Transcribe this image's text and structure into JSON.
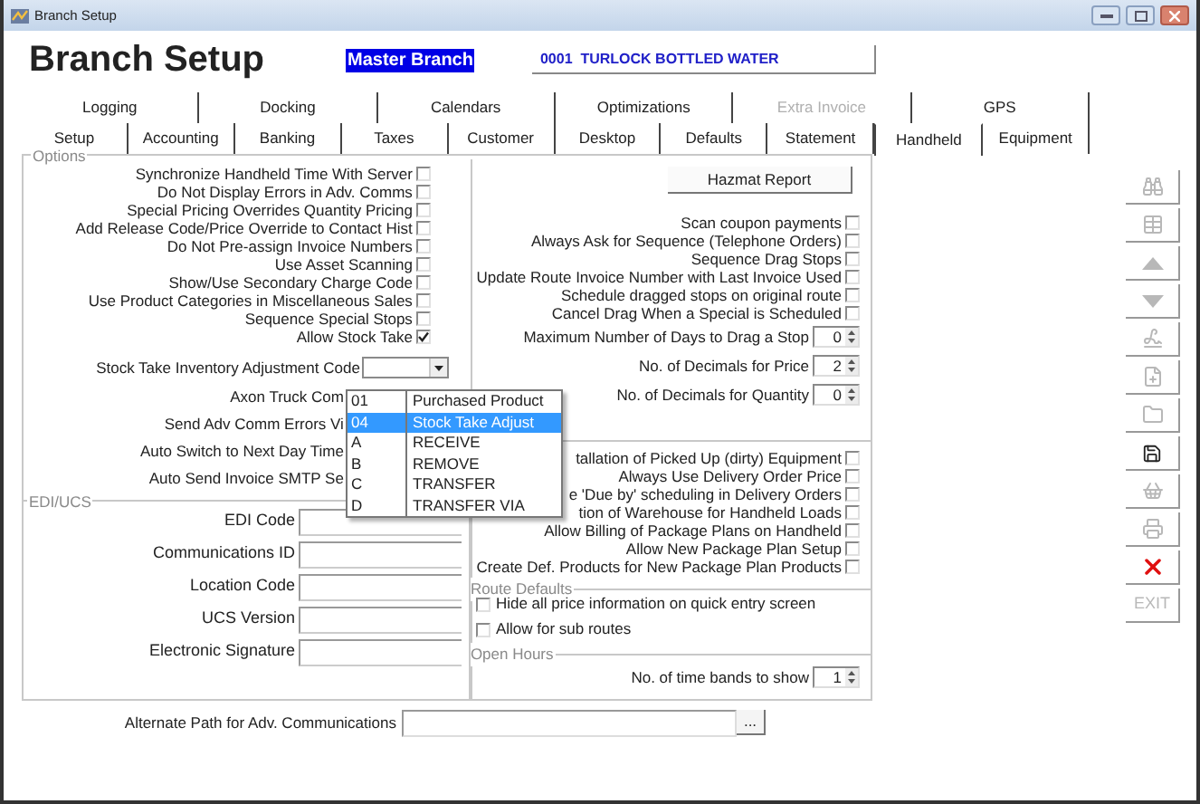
{
  "window": {
    "title": "Branch Setup"
  },
  "header": {
    "title": "Branch Setup",
    "branch_label": "Master Branch",
    "branch_value": "0001  TURLOCK BOTTLED WATER"
  },
  "tabs_row_1": [
    {
      "label": "Logging",
      "selected": false,
      "disabled": false
    },
    {
      "label": "Docking",
      "selected": false,
      "disabled": false
    },
    {
      "label": "Calendars",
      "selected": false,
      "disabled": false
    },
    {
      "label": "Optimizations",
      "selected": false,
      "disabled": false
    },
    {
      "label": "Extra Invoice",
      "selected": false,
      "disabled": true
    },
    {
      "label": "GPS",
      "selected": false,
      "disabled": false
    }
  ],
  "tabs_row_2": [
    {
      "label": "Setup",
      "selected": false,
      "disabled": false
    },
    {
      "label": "Accounting",
      "selected": false,
      "disabled": false
    },
    {
      "label": "Banking",
      "selected": false,
      "disabled": false
    },
    {
      "label": "Taxes",
      "selected": false,
      "disabled": false
    },
    {
      "label": "Customer",
      "selected": false,
      "disabled": false
    },
    {
      "label": "Desktop",
      "selected": false,
      "disabled": false
    },
    {
      "label": "Defaults",
      "selected": false,
      "disabled": false
    },
    {
      "label": "Statement",
      "selected": false,
      "disabled": false
    },
    {
      "label": "Handheld",
      "selected": true,
      "disabled": false
    },
    {
      "label": "Equipment",
      "selected": false,
      "disabled": false
    }
  ],
  "options": {
    "legend": "Options",
    "left_checks": [
      {
        "label": "Synchronize Handheld Time With Server",
        "checked": false
      },
      {
        "label": "Do Not Display Errors in Adv. Comms",
        "checked": false
      },
      {
        "label": "Special Pricing Overrides Quantity Pricing",
        "checked": false
      },
      {
        "label": "Add Release Code/Price Override to Contact Hist",
        "checked": false
      },
      {
        "label": "Do Not Pre-assign Invoice Numbers",
        "checked": false
      },
      {
        "label": "Use Asset Scanning",
        "checked": false
      },
      {
        "label": "Show/Use Secondary Charge Code",
        "checked": false
      },
      {
        "label": "Use Product Categories in Miscellaneous Sales",
        "checked": false
      },
      {
        "label": "Sequence Special Stops",
        "checked": false
      },
      {
        "label": "Allow Stock Take",
        "checked": true
      }
    ],
    "stock_take_label": "Stock Take Inventory Adjustment Code",
    "left_partial": [
      "Axon Truck Com",
      "Send Adv Comm Errors Vi",
      "Auto Switch to Next Day Time",
      "Auto Send Invoice SMTP Se"
    ],
    "hazmat_button": "Hazmat Report",
    "right_checks": [
      {
        "label": "Scan coupon payments",
        "checked": false
      },
      {
        "label": "Always Ask for Sequence (Telephone Orders)",
        "checked": false
      },
      {
        "label": "Sequence Drag Stops",
        "checked": false
      },
      {
        "label": "Update Route Invoice Number with Last Invoice Used",
        "checked": false
      },
      {
        "label": "Schedule dragged stops on original route",
        "checked": false
      },
      {
        "label": "Cancel Drag When a Special is Scheduled",
        "checked": false
      }
    ],
    "spinners": [
      {
        "label": "Maximum Number of Days to Drag a Stop",
        "value": "0"
      },
      {
        "label": "No. of Decimals for Price",
        "value": "2"
      },
      {
        "label": "No. of Decimals for Quantity",
        "value": "0"
      }
    ],
    "right_checks_2": [
      {
        "label": "tallation of Picked Up (dirty) Equipment",
        "checked": false
      },
      {
        "label": "Always Use Delivery Order Price",
        "checked": false
      },
      {
        "label": "e 'Due by' scheduling in Delivery Orders",
        "checked": false
      },
      {
        "label": "tion of Warehouse for Handheld Loads",
        "checked": false
      },
      {
        "label": "Allow Billing of Package Plans on Handheld",
        "checked": false
      },
      {
        "label": "Allow New Package Plan Setup",
        "checked": false
      },
      {
        "label": "Create Def. Products for New Package Plan Products",
        "checked": false
      }
    ]
  },
  "dropdown": [
    {
      "code": "01",
      "label": "Purchased Product",
      "selected": false
    },
    {
      "code": "04",
      "label": "Stock Take Adjust",
      "selected": true
    },
    {
      "code": "A",
      "label": "RECEIVE",
      "selected": false
    },
    {
      "code": "B",
      "label": "REMOVE",
      "selected": false
    },
    {
      "code": "C",
      "label": "TRANSFER",
      "selected": false
    },
    {
      "code": "D",
      "label": "TRANSFER VIA",
      "selected": false
    }
  ],
  "edi_ucs": {
    "legend": "EDI/UCS",
    "fields": [
      "EDI Code",
      "Communications ID",
      "Location Code",
      "UCS Version",
      "Electronic Signature"
    ]
  },
  "route_defaults": {
    "legend": "Route Defaults",
    "checks": [
      {
        "label": "Hide all price information on quick entry screen",
        "checked": false
      },
      {
        "label": "Allow for sub routes",
        "checked": false
      }
    ]
  },
  "open_hours": {
    "legend": "Open Hours",
    "label": "No. of time bands to show",
    "value": "1"
  },
  "alternate_path": {
    "label": "Alternate Path for Adv. Communications",
    "button": "..."
  },
  "toolbar": [
    {
      "kind": "binoculars",
      "disabled": true
    },
    {
      "kind": "grid",
      "disabled": true
    },
    {
      "kind": "up",
      "disabled": true
    },
    {
      "kind": "down",
      "disabled": true
    },
    {
      "kind": "signature",
      "disabled": true
    },
    {
      "kind": "add",
      "disabled": true
    },
    {
      "kind": "folder",
      "disabled": true
    },
    {
      "kind": "save",
      "disabled": false
    },
    {
      "kind": "basket",
      "disabled": true
    },
    {
      "kind": "print",
      "disabled": true
    },
    {
      "kind": "close",
      "disabled": false
    },
    {
      "kind": "text",
      "label": "EXIT",
      "disabled": true
    }
  ]
}
